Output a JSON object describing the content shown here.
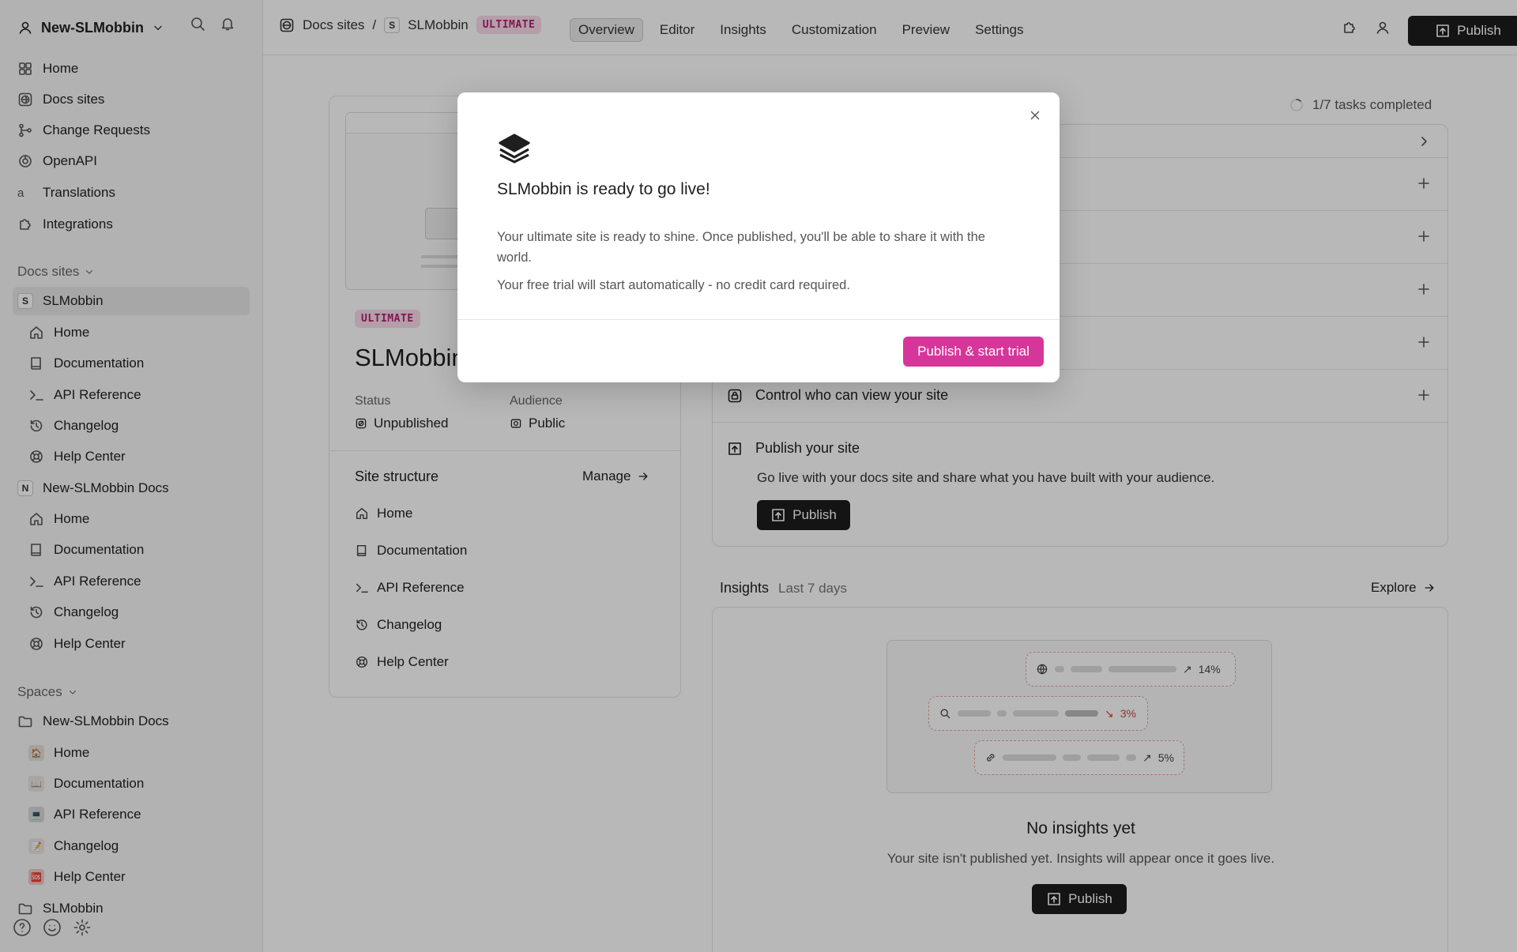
{
  "sidebar": {
    "org_name": "New-SLMobbin",
    "nav": [
      "Home",
      "Docs sites",
      "Change Requests",
      "OpenAPI",
      "Translations",
      "Integrations"
    ],
    "docs_sites_label": "Docs sites",
    "site1": {
      "badge": "S",
      "name": "SLMobbin",
      "items": [
        "Home",
        "Documentation",
        "API Reference",
        "Changelog",
        "Help Center"
      ]
    },
    "site2": {
      "badge": "N",
      "name": "New-SLMobbin Docs",
      "items": [
        "Home",
        "Documentation",
        "API Reference",
        "Changelog",
        "Help Center"
      ]
    },
    "spaces_label": "Spaces",
    "space1": {
      "name": "New-SLMobbin Docs",
      "items": [
        "Home",
        "Documentation",
        "API Reference",
        "Changelog",
        "Help Center"
      ]
    },
    "space2": {
      "name": "SLMobbin"
    }
  },
  "topbar": {
    "crumb_root": "Docs sites",
    "crumb_sep": "/",
    "site_badge": "S",
    "site_name": "SLMobbin",
    "plan": "ULTIMATE",
    "tabs": [
      "Overview",
      "Editor",
      "Insights",
      "Customization",
      "Preview",
      "Settings"
    ],
    "publish": "Publish"
  },
  "site_card": {
    "plan": "ULTIMATE",
    "title": "SLMobbin",
    "status_label": "Status",
    "status_value": "Unpublished",
    "audience_label": "Audience",
    "audience_value": "Public",
    "structure_title": "Site structure",
    "manage": "Manage",
    "structure": [
      "Home",
      "Documentation",
      "API Reference",
      "Changelog",
      "Help Center"
    ]
  },
  "tasks": {
    "progress": "1/7 tasks completed",
    "control": "Control who can view your site",
    "publish_title": "Publish your site",
    "publish_desc": "Go live with your docs site and share what you have built with your audience.",
    "publish_btn": "Publish"
  },
  "insights": {
    "title": "Insights",
    "range": "Last 7 days",
    "explore": "Explore",
    "pct1": "14%",
    "pct2": "3%",
    "pct3": "5%",
    "empty_title": "No insights yet",
    "empty_desc": "Your site isn't published yet. Insights will appear once it goes live.",
    "publish_btn": "Publish"
  },
  "modal": {
    "title": "SLMobbin is ready to go live!",
    "text1": "Your ultimate site is ready to shine. Once published, you'll be able to share it with the world.",
    "text2": "Your free trial will start automatically - no credit card required.",
    "cta": "Publish & start trial"
  },
  "colors": {
    "accent": "#d6369a",
    "plan_text": "#b3206f",
    "dark_button": "#1c1c1c"
  }
}
